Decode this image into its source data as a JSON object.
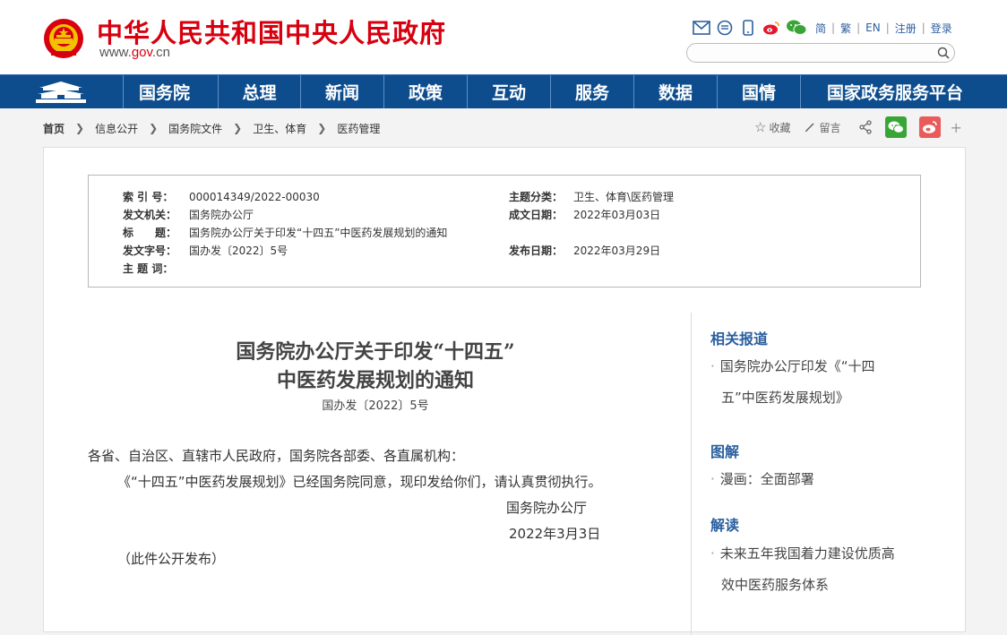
{
  "header": {
    "site_title": "中华人民共和国中央人民政府",
    "site_url_prefix": "www.",
    "site_url_gov": "gov",
    "site_url_suffix": ".cn",
    "lang": [
      "简",
      "繁",
      "EN"
    ],
    "register": "注册",
    "login": "登录",
    "search_placeholder": ""
  },
  "nav": {
    "items": [
      "国务院",
      "总理",
      "新闻",
      "政策",
      "互动",
      "服务",
      "数据",
      "国情",
      "国家政务服务平台"
    ]
  },
  "breadcrumb": [
    "首页",
    "信息公开",
    "国务院文件",
    "卫生、体育",
    "医药管理"
  ],
  "tools": {
    "favorite": "收藏",
    "comment": "留言",
    "plus": "+"
  },
  "info": {
    "index_label": "索 引 号：",
    "index_value": "000014349/2022-00030",
    "topic_label": "主题分类：",
    "topic_value": "卫生、体育\\医药管理",
    "issuer_label": "发文机关：",
    "issuer_value": "国务院办公厅",
    "date_label": "成文日期：",
    "date_value": "2022年03月03日",
    "title_label": "标　　题：",
    "title_value": "国务院办公厅关于印发“十四五”中医药发展规划的通知",
    "docno_label": "发文字号：",
    "docno_value": "国办发〔2022〕5号",
    "pubdate_label": "发布日期：",
    "pubdate_value": "2022年03月29日",
    "keywords_label": "主 题 词："
  },
  "article": {
    "title_line1": "国务院办公厅关于印发“十四五”",
    "title_line2": "中医药发展规划的通知",
    "doc_no": "国办发〔2022〕5号",
    "salutation": "各省、自治区、直辖市人民政府，国务院各部委、各直属机构：",
    "body": "《“十四五”中医药发展规划》已经国务院同意，现印发给你们，请认真贯彻执行。",
    "signer": "国务院办公厅",
    "sign_date": "2022年3月3日",
    "note": "（此件公开发布）"
  },
  "sidebar": {
    "related_heading": "相关报道",
    "related_line1": "国务院办公厅印发《“十四",
    "related_line2": "五”中医药发展规划》",
    "graphic_heading": "图解",
    "graphic_item": "漫画：全面部署",
    "interpret_heading": "解读",
    "interpret_line1": "未来五年我国着力建设优质高",
    "interpret_line2": "效中医药服务体系"
  },
  "colors": {
    "brand_red": "#d7000f",
    "nav_blue": "#0d4d8e",
    "link_blue": "#2a5f9e"
  },
  "icons": [
    "national-emblem-icon",
    "mail-icon",
    "message-icon",
    "mobile-icon",
    "weibo-icon",
    "wechat-icon",
    "search-icon",
    "star-icon",
    "pencil-icon",
    "share-icon",
    "tiananmen-home-icon"
  ]
}
